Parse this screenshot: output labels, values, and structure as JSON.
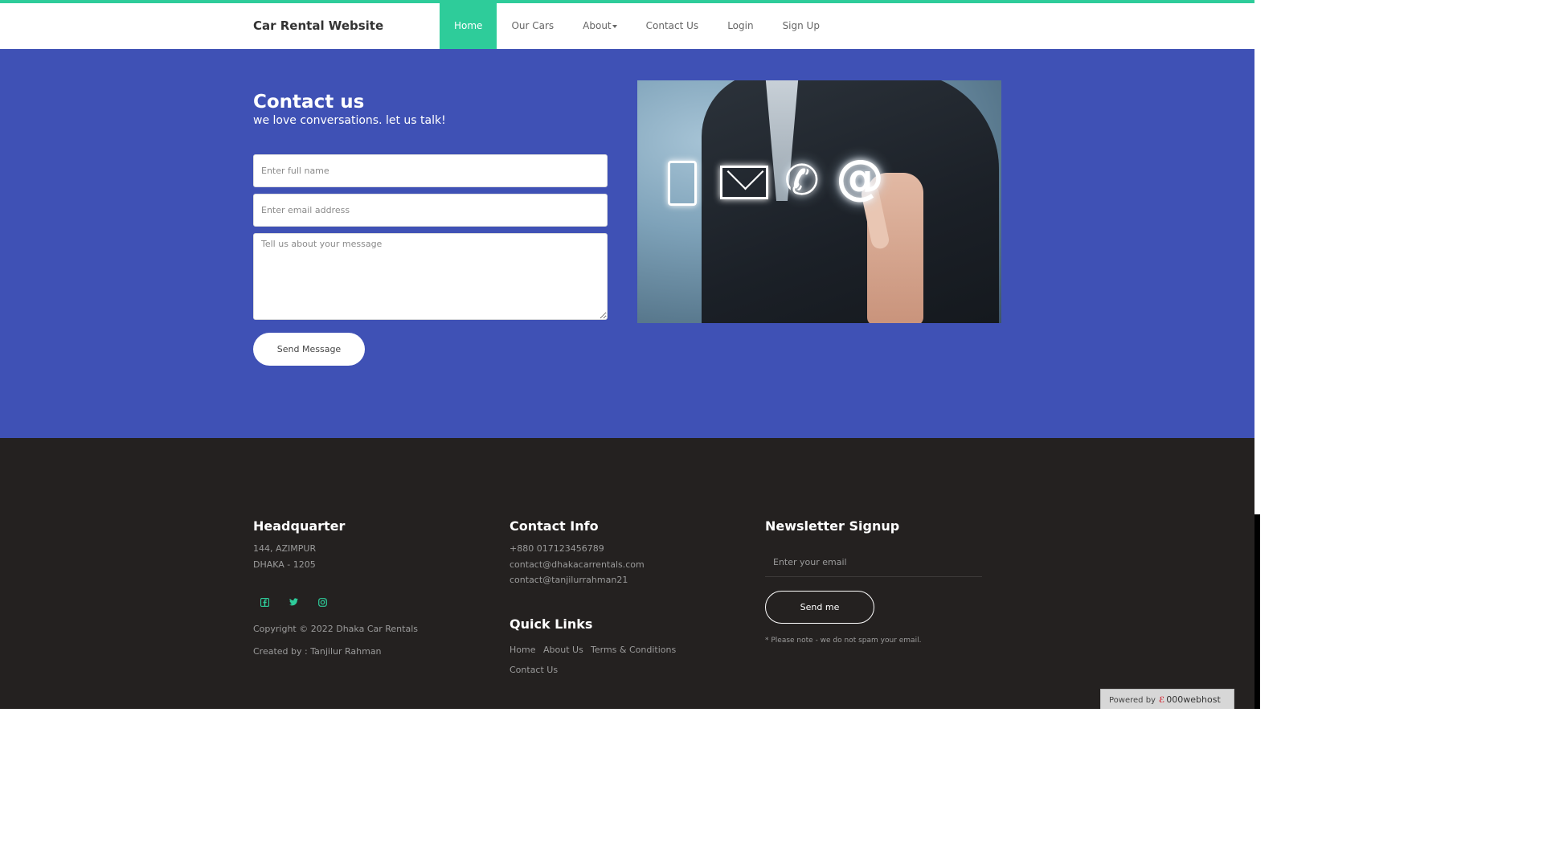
{
  "nav": {
    "brand": "Car Rental Website",
    "items": [
      {
        "label": "Home",
        "active": true
      },
      {
        "label": "Our Cars"
      },
      {
        "label": "About",
        "dropdown": true
      },
      {
        "label": "Contact Us"
      },
      {
        "label": "Login"
      },
      {
        "label": "Sign Up"
      }
    ]
  },
  "contact": {
    "title": "Contact us",
    "subtitle": "we love conversations. let us talk!",
    "name_placeholder": "Enter full name",
    "email_placeholder": "Enter email address",
    "message_placeholder": "Tell us about your message",
    "send_label": "Send Message"
  },
  "footer": {
    "hq": {
      "title": "Headquarter",
      "line1": "144, AZIMPUR",
      "line2": "DHAKA - 1205",
      "social": [
        "facebook-icon",
        "twitter-icon",
        "instagram-icon"
      ],
      "copyright": "Copyright © 2022 Dhaka Car Rentals",
      "created": "Created by : Tanjilur Rahman"
    },
    "contact_info": {
      "title": "Contact Info",
      "phone": "+880 017123456789",
      "email1": "contact@dhakacarrentals.com",
      "email2": "contact@tanjilurrahman21"
    },
    "quick_links": {
      "title": "Quick Links",
      "links": [
        "Home",
        "About Us",
        "Terms & Conditions",
        "Contact Us"
      ]
    },
    "newsletter": {
      "title": "Newsletter Signup",
      "placeholder": "Enter your email",
      "button": "Send me",
      "note": "* Please note - we do not spam your email."
    }
  },
  "badge": {
    "powered": "Powered by",
    "host": "000webhost"
  },
  "colors": {
    "accent": "#2ecc9a",
    "contact_bg": "#3f51b5",
    "footer_bg": "#242120"
  }
}
